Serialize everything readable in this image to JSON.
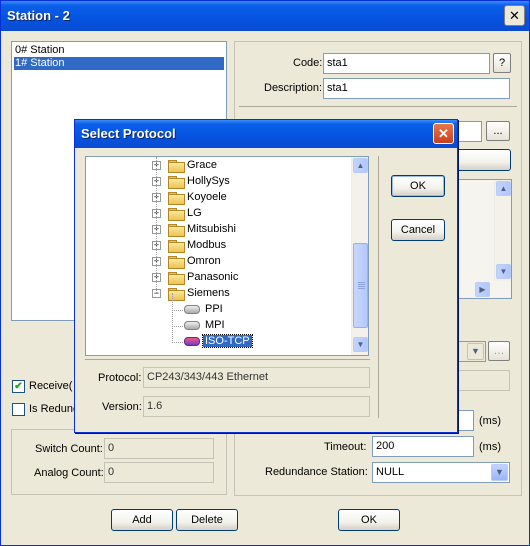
{
  "window": {
    "title": "Station - 2",
    "close_label": "✕"
  },
  "station_list": [
    "0# Station",
    "1# Station"
  ],
  "code": {
    "label": "Code:",
    "value": "sta1",
    "help_label": "?"
  },
  "description": {
    "label": "Description:",
    "value": "sta1"
  },
  "browse_label": "...",
  "receive_checkbox": {
    "label": "Receive(",
    "checked": true
  },
  "redundant_checkbox": {
    "label": "Is Redunc",
    "checked": false
  },
  "switch_count": {
    "label": "Switch Count:",
    "value": "0"
  },
  "analog_count": {
    "label": "Analog Count:",
    "value": "0"
  },
  "timeout": {
    "label": "Timeout:",
    "value": "200",
    "unit": "(ms)"
  },
  "other_unit": "(ms)",
  "redundance_station": {
    "label": "Redundance Station:",
    "value": "NULL"
  },
  "buttons": {
    "add": "Add",
    "delete": "Delete",
    "ok": "OK"
  },
  "dialog": {
    "title": "Select Protocol",
    "close_label": "✕",
    "ok": "OK",
    "cancel": "Cancel",
    "tree": [
      {
        "label": "Grace",
        "type": "folder",
        "expander": "+"
      },
      {
        "label": "HollySys",
        "type": "folder",
        "expander": "+"
      },
      {
        "label": "Koyoele",
        "type": "folder",
        "expander": "+"
      },
      {
        "label": "LG",
        "type": "folder",
        "expander": "+"
      },
      {
        "label": "Mitsubishi",
        "type": "folder",
        "expander": "+"
      },
      {
        "label": "Modbus",
        "type": "folder",
        "expander": "+"
      },
      {
        "label": "Omron",
        "type": "folder",
        "expander": "+"
      },
      {
        "label": "Panasonic",
        "type": "folder",
        "expander": "+"
      },
      {
        "label": "Siemens",
        "type": "folder-open",
        "expander": "−"
      },
      {
        "label": "PPI",
        "type": "protocol"
      },
      {
        "label": "MPI",
        "type": "protocol"
      },
      {
        "label": "ISO-TCP",
        "type": "protocol-selected"
      }
    ],
    "protocol": {
      "label": "Protocol:",
      "value": "CP243/343/443 Ethernet"
    },
    "version": {
      "label": "Version:",
      "value": "1.6"
    }
  },
  "colors": {
    "titlebar": "#0553E0",
    "selection": "#316AC5",
    "face": "#ECE9D8"
  }
}
